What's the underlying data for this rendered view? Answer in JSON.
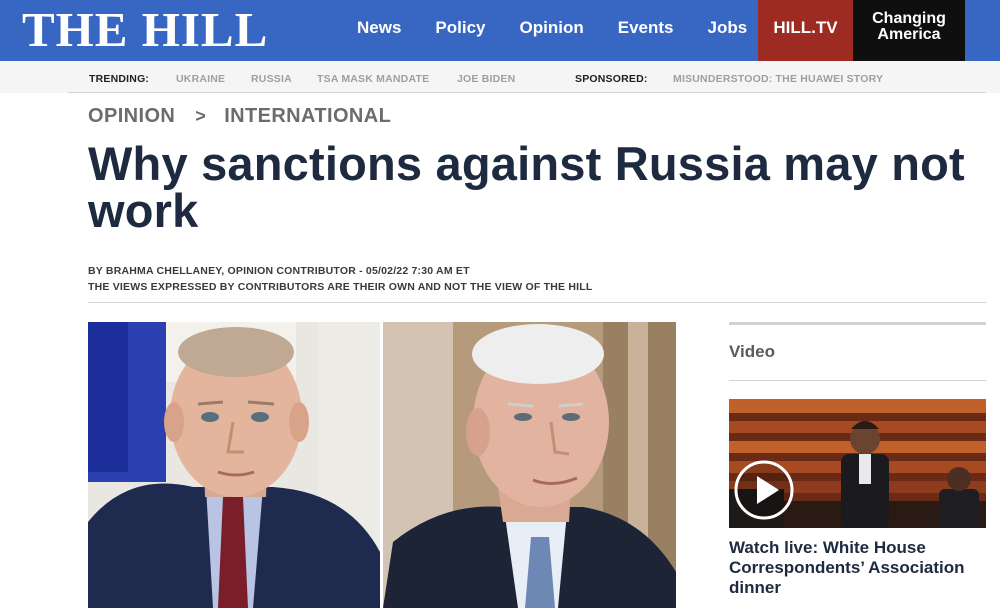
{
  "header": {
    "logo": "THE HILL",
    "nav": [
      "News",
      "Policy",
      "Opinion",
      "Events",
      "Jobs"
    ],
    "hilltv": "HILL.TV",
    "changing_line1": "Changing",
    "changing_line2": "America",
    "colors": {
      "bar": "#3766c3",
      "hilltv": "#9d2b22",
      "changing": "#0f0f10"
    }
  },
  "trending": {
    "label": "TRENDING:",
    "items": [
      "UKRAINE",
      "RUSSIA",
      "TSA MASK MANDATE",
      "JOE BIDEN"
    ],
    "sponsored_label": "SPONSORED:",
    "sponsored_item": "MISUNDERSTOOD: THE HUAWEI STORY"
  },
  "article": {
    "breadcrumb": [
      "OPINION",
      "INTERNATIONAL"
    ],
    "breadcrumb_sep": ">",
    "headline": "Why sanctions against Russia may not work",
    "byline": "BY BRAHMA CHELLANEY, OPINION CONTRIBUTOR - 05/02/22 7:30 AM ET",
    "disclaimer": "THE VIEWS EXPRESSED BY CONTRIBUTORS ARE THEIR OWN AND NOT THE VIEW OF THE HILL"
  },
  "rail": {
    "section_title": "Video",
    "video_title": "Watch live: White House Correspondents’ Association dinner",
    "play_icon": "play-icon"
  }
}
